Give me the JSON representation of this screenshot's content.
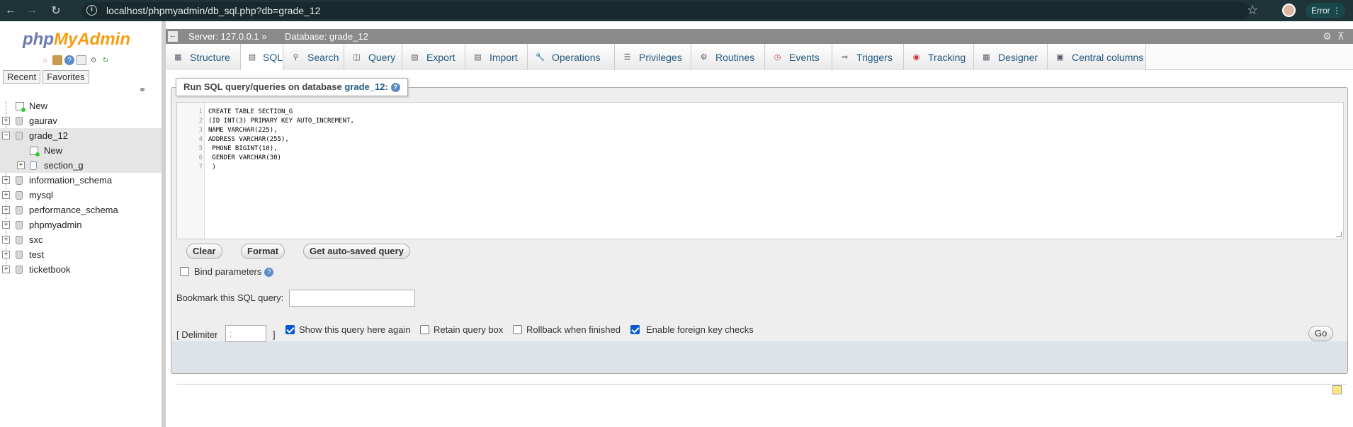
{
  "browser": {
    "url": "localhost/phpmyadmin/db_sql.php?db=grade_12",
    "error_label": "Error",
    "icons": [
      "back-icon",
      "forward-icon",
      "reload-icon",
      "info-icon",
      "star-icon",
      "menu-icon"
    ]
  },
  "sidebar": {
    "logo_php": "php",
    "logo_my": "MyAdmin",
    "recent_label": "Recent",
    "favorites_label": "Favorites",
    "tree": [
      {
        "label": "New",
        "type": "new",
        "level": 0
      },
      {
        "label": "gaurav",
        "type": "db",
        "level": 0
      },
      {
        "label": "grade_12",
        "type": "db",
        "level": 0,
        "expanded": true,
        "selected": true
      },
      {
        "label": "New",
        "type": "new",
        "level": 1
      },
      {
        "label": "section_g",
        "type": "table",
        "level": 1
      },
      {
        "label": "information_schema",
        "type": "db",
        "level": 0
      },
      {
        "label": "mysql",
        "type": "db",
        "level": 0
      },
      {
        "label": "performance_schema",
        "type": "db",
        "level": 0
      },
      {
        "label": "phpmyadmin",
        "type": "db",
        "level": 0
      },
      {
        "label": "sxc",
        "type": "db",
        "level": 0
      },
      {
        "label": "test",
        "type": "db",
        "level": 0
      },
      {
        "label": "ticketbook",
        "type": "db",
        "level": 0
      }
    ]
  },
  "breadcrumb": {
    "server": "Server: 127.0.0.1 »",
    "database": "Database: grade_12"
  },
  "tabs": [
    {
      "label": "Structure",
      "icon": "structure-icon"
    },
    {
      "label": "SQL",
      "icon": "sql-icon",
      "active": true
    },
    {
      "label": "Search",
      "icon": "search-icon"
    },
    {
      "label": "Query",
      "icon": "query-icon"
    },
    {
      "label": "Export",
      "icon": "export-icon"
    },
    {
      "label": "Import",
      "icon": "import-icon"
    },
    {
      "label": "Operations",
      "icon": "wrench-icon"
    },
    {
      "label": "Privileges",
      "icon": "privileges-icon"
    },
    {
      "label": "Routines",
      "icon": "routines-icon"
    },
    {
      "label": "Events",
      "icon": "clock-icon"
    },
    {
      "label": "Triggers",
      "icon": "triggers-icon"
    },
    {
      "label": "Tracking",
      "icon": "eye-icon"
    },
    {
      "label": "Designer",
      "icon": "designer-icon"
    },
    {
      "label": "Central columns",
      "icon": "central-columns-icon"
    }
  ],
  "query_panel": {
    "legend_prefix": "Run SQL query/queries on database",
    "legend_db": "grade_12:",
    "code_lines": [
      "CREATE TABLE SECTION_G",
      "(ID INT(3) PRIMARY KEY AUTO_INCREMENT,",
      "NAME VARCHAR(225),",
      "ADDRESS VARCHAR(255),",
      " PHONE BIGINT(10),",
      " GENDER VARCHAR(30)",
      " )"
    ],
    "clear_label": "Clear",
    "format_label": "Format",
    "autosaved_label": "Get auto-saved query",
    "bind_params_label": "Bind parameters",
    "bookmark_label": "Bookmark this SQL query:",
    "bookmark_value": ""
  },
  "options": {
    "delimiter_label": "[ Delimiter",
    "delimiter_value": ";",
    "delimiter_close": "]",
    "show_query_label": "Show this query here again",
    "show_query_checked": true,
    "retain_label": "Retain query box",
    "retain_checked": false,
    "rollback_label": "Rollback when finished",
    "rollback_checked": false,
    "foreign_key_label": "Enable foreign key checks",
    "foreign_key_checked": true,
    "go_label": "Go"
  }
}
